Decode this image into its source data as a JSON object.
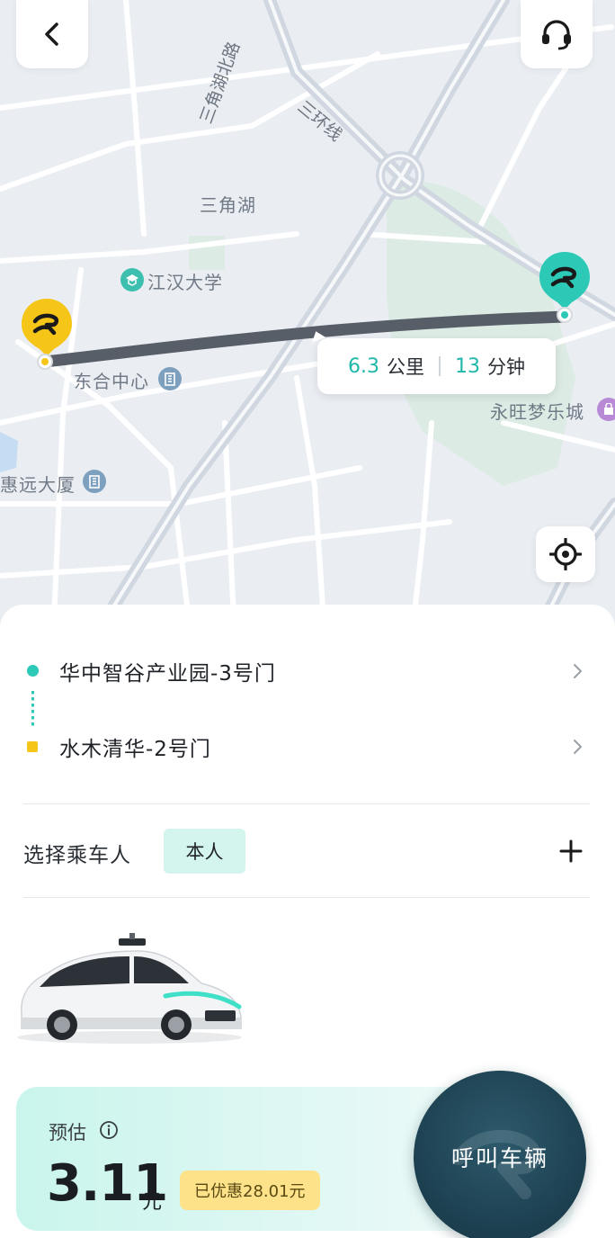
{
  "map": {
    "labels": {
      "road_sanjiaohu_north": "三角湖北路",
      "road_third_ring": "三环线",
      "lake": "三角湖",
      "university": "江汉大学",
      "center": "东合中心",
      "mall": "永旺梦乐城",
      "building": "惠远大厦"
    },
    "route": {
      "distance_value": "6.3",
      "distance_unit": "公里",
      "time_value": "13",
      "time_unit": "分钟"
    },
    "icons": {
      "back": "chevron-left-icon",
      "service": "headset-icon",
      "locate": "crosshair-icon"
    }
  },
  "trip": {
    "pickup": "华中智谷产业园-3号门",
    "dropoff": "水木清华-2号门"
  },
  "passenger": {
    "label": "选择乘车人",
    "selected": "本人"
  },
  "pricing": {
    "estimate_label": "预估",
    "price": "3.11",
    "unit": "元",
    "discount": "已优惠28.01元"
  },
  "cta": {
    "label": "呼叫车辆"
  },
  "colors": {
    "teal": "#2cc9b6",
    "yellow": "#f5c518",
    "route_line": "#585e68",
    "cta_bg": "#1c3f4f",
    "discount_bg": "#fde28a"
  }
}
